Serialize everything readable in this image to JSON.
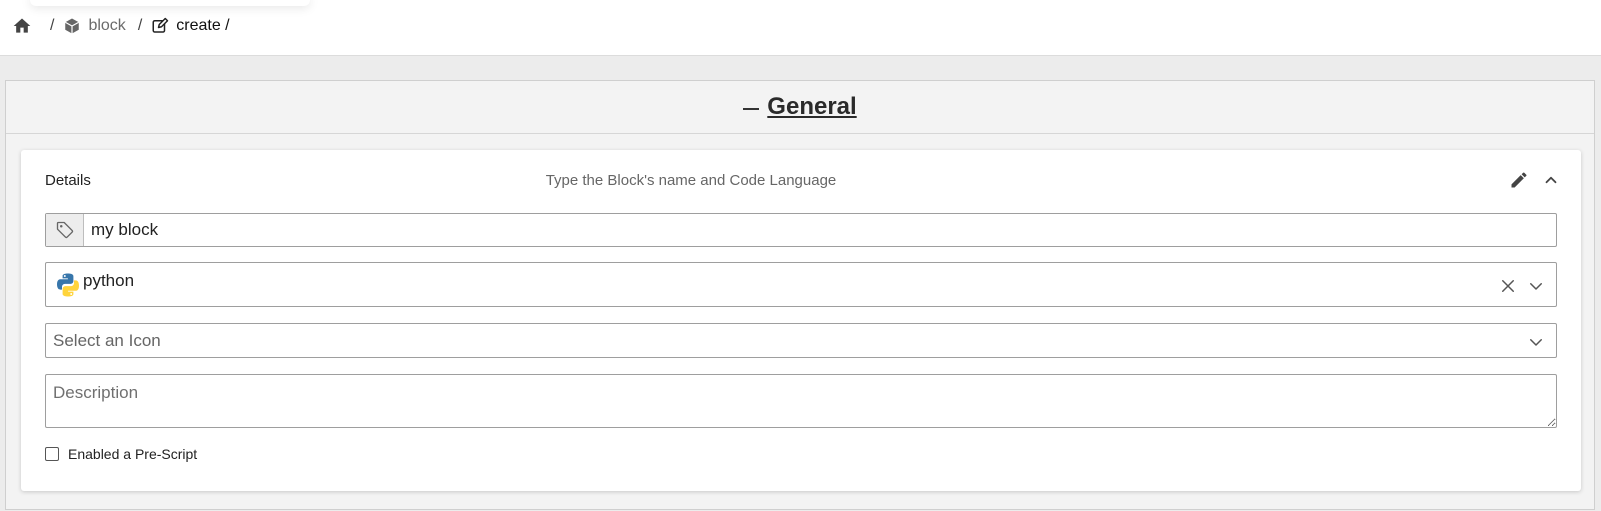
{
  "breadcrumb": {
    "home_icon": "home-icon",
    "separator": "/",
    "items": [
      {
        "label": "block",
        "icon": "cube-icon"
      },
      {
        "label": "create /",
        "icon": "edit-icon"
      }
    ]
  },
  "general": {
    "title": "General",
    "toggle_icon": "minus-icon"
  },
  "details": {
    "label": "Details",
    "subtitle": "Type the Block's name and Code Language",
    "edit_icon": "pencil-icon",
    "collapse_icon": "chevron-up-icon",
    "name": {
      "value": "my block",
      "icon": "tag-icon"
    },
    "language": {
      "value": "python",
      "logo": "python-logo-icon",
      "clear_icon": "clear-icon",
      "caret_icon": "chevron-down-icon"
    },
    "icon_select": {
      "placeholder": "Select an Icon",
      "caret_icon": "chevron-down-icon"
    },
    "description": {
      "placeholder": "Description",
      "value": ""
    },
    "prescript": {
      "label": "Enabled a Pre-Script",
      "checked": false
    }
  },
  "colors": {
    "page_background": "#ececec",
    "panel_background": "#f3f3f3",
    "card_background": "#ffffff",
    "python_blue": "#3776ab",
    "python_yellow": "#ffd43b"
  }
}
